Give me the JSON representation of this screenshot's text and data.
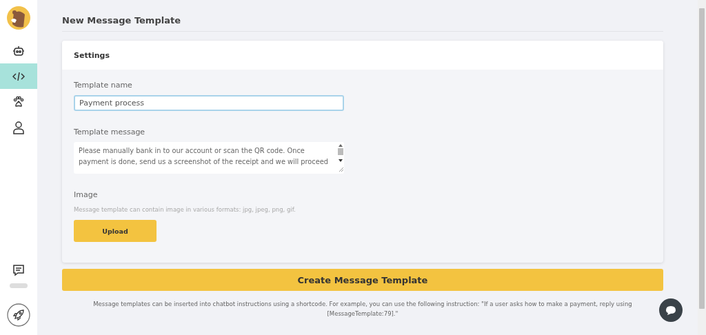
{
  "sidebar": {
    "items": [
      {
        "kind": "robot",
        "selected": false
      },
      {
        "kind": "code",
        "selected": true
      },
      {
        "kind": "paw",
        "selected": false
      },
      {
        "kind": "user",
        "selected": false
      }
    ]
  },
  "page_title": "New Message Template",
  "settings_card": {
    "title": "Settings",
    "template_name": {
      "label": "Template name",
      "value": "Payment process"
    },
    "template_message": {
      "label": "Template message",
      "value": "Please manually bank in to our account or scan the QR code. Once payment is done, send us a screenshot of the receipt and we will proceed"
    },
    "image": {
      "label": "Image",
      "hint": "Message template can contain image in various formats: jpg, jpeg, png, gif.",
      "button": "Upload"
    }
  },
  "create_button": "Create Message Template",
  "note": "Message templates can be inserted into chatbot instructions using a shortcode. For example, you can use the following instruction: \"If a user asks how to make a payment, reply using [MessageTemplate:79].\""
}
